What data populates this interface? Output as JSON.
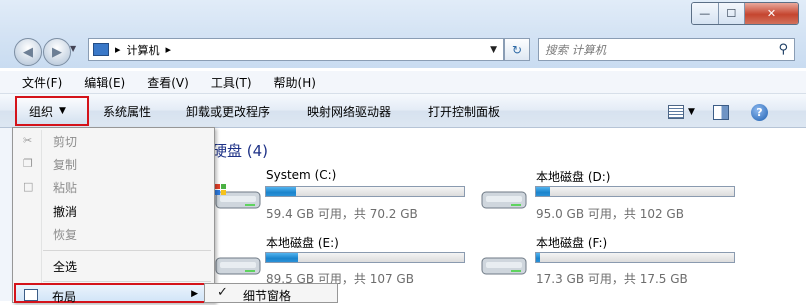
{
  "window": {
    "caption_buttons": [
      "—",
      "☐",
      "✕"
    ]
  },
  "nav": {
    "back_icon": "back-arrow-icon",
    "forward_icon": "forward-arrow-icon"
  },
  "address": {
    "separator1": "▸",
    "crumb": "计算机",
    "separator2": "▸"
  },
  "search": {
    "placeholder": "搜索 计算机"
  },
  "menubar": [
    "文件(F)",
    "编辑(E)",
    "查看(V)",
    "工具(T)",
    "帮助(H)"
  ],
  "commandbar": {
    "organize": "组织",
    "items": [
      "系统属性",
      "卸载或更改程序",
      "映射网络驱动器",
      "打开控制面板"
    ],
    "help": "?"
  },
  "content": {
    "section_title": "硬盘 (4)",
    "drives": [
      {
        "name": "System (C:)",
        "info": "59.4 GB 可用，共 70.2 GB",
        "used_fraction": 0.15
      },
      {
        "name": "本地磁盘 (D:)",
        "info": "95.0 GB 可用，共 102 GB",
        "used_fraction": 0.07
      },
      {
        "name": "本地磁盘 (E:)",
        "info": "89.5 GB 可用，共 107 GB",
        "used_fraction": 0.16
      },
      {
        "name": "本地磁盘 (F:)",
        "info": "17.3 GB 可用，共 17.5 GB",
        "used_fraction": 0.02
      }
    ]
  },
  "organize_menu": {
    "items": [
      {
        "label": "剪切",
        "disabled": true
      },
      {
        "label": "复制",
        "disabled": true
      },
      {
        "label": "粘贴",
        "disabled": true
      },
      {
        "label": "撤消",
        "disabled": false
      },
      {
        "label": "恢复",
        "disabled": true
      },
      {
        "label": "全选",
        "disabled": false
      }
    ],
    "layout": "布局",
    "layout_submenu_item": "细节窗格",
    "layout_submenu_check": "✓"
  },
  "colors": {
    "accent": "#1e3287",
    "highlight_border": "#d4131a",
    "bar_fill": "#1b84cc"
  }
}
